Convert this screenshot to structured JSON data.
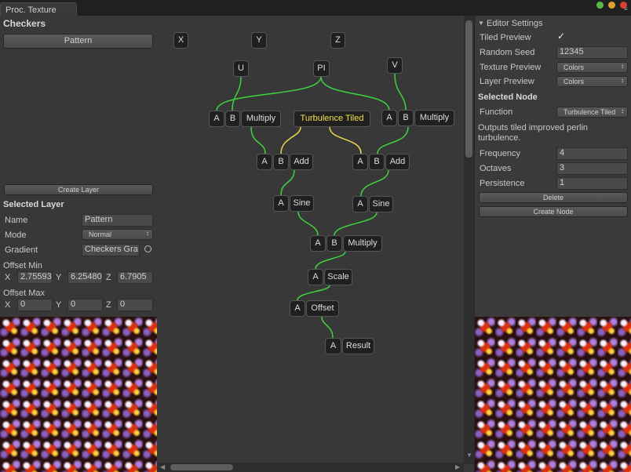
{
  "window": {
    "tab_title": "Proc. Texture"
  },
  "left": {
    "texture_name": "Checkers",
    "pattern_button": "Pattern",
    "create_layer_button": "Create Layer",
    "selected_layer_header": "Selected Layer",
    "name_label": "Name",
    "name_value": "Pattern",
    "mode_label": "Mode",
    "mode_value": "Normal",
    "gradient_label": "Gradient",
    "gradient_value": "Checkers Gra",
    "offset_min_label": "Offset Min",
    "offset_min": {
      "x_label": "X",
      "x": "2.75593",
      "y_label": "Y",
      "y": "6.25480",
      "z_label": "Z",
      "z": "6.7905"
    },
    "offset_max_label": "Offset Max",
    "offset_max": {
      "x_label": "X",
      "x": "0",
      "y_label": "Y",
      "y": "0",
      "z_label": "Z",
      "z": "0"
    }
  },
  "graph": {
    "inputs": {
      "x": "X",
      "y": "Y",
      "z": "Z",
      "u": "U",
      "pi": "PI",
      "v": "V"
    },
    "ports": {
      "a": "A",
      "b": "B"
    },
    "multiply_left": "Multiply",
    "turbulence": "Turbulence Tiled",
    "multiply_right": "Multiply",
    "add_left": "Add",
    "add_right": "Add",
    "sine_left": "Sine",
    "sine_right": "Sine",
    "multiply_center": "Multiply",
    "scale": "Scale",
    "offset": "Offset",
    "result": "Result"
  },
  "right": {
    "editor_settings_header": "Editor Settings",
    "tiled_preview_label": "Tiled Preview",
    "tiled_preview_checked": true,
    "tiled_preview_check": "✓",
    "random_seed_label": "Random Seed",
    "random_seed_value": "12345",
    "texture_preview_label": "Texture Preview",
    "texture_preview_value": "Colors",
    "layer_preview_label": "Layer Preview",
    "layer_preview_value": "Colors",
    "selected_node_header": "Selected Node",
    "function_label": "Function",
    "function_value": "Turbulence Tiled",
    "description": "Outputs tiled improved perlin turbulence.",
    "frequency_label": "Frequency",
    "frequency_value": "4",
    "octaves_label": "Octaves",
    "octaves_value": "3",
    "persistence_label": "Persistence",
    "persistence_value": "1",
    "delete_button": "Delete",
    "create_node_button": "Create Node"
  },
  "colors": {
    "wire_green": "#3fd43f",
    "wire_yellow": "#e8d84a",
    "node_text_highlight": "#f0e24a"
  }
}
